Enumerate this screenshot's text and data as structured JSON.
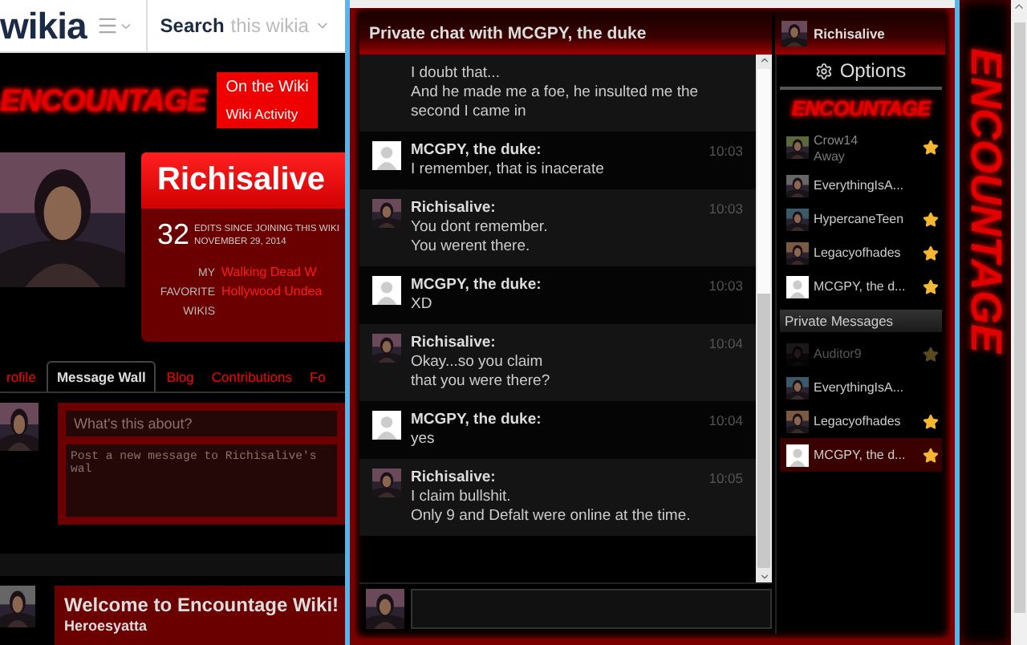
{
  "wiki": {
    "brand": "wikia",
    "search_label": "Search",
    "search_placeholder": "this wikia",
    "logo": "ENCOUNTAGE",
    "nav": {
      "title": "On the Wiki",
      "item": "Wiki Activity"
    },
    "profile": {
      "name": "Richisalive",
      "edits": "32",
      "edits_label": "EDITS SINCE JOINING THIS WIKI",
      "joined": "NOVEMBER 29, 2014",
      "favorites_label": "MY FAVORITE WIKIS",
      "favorites": [
        "Walking Dead W",
        "Hollywood Undea"
      ]
    },
    "tabs": [
      {
        "label": "rofile",
        "selected": false
      },
      {
        "label": "Message Wall",
        "selected": true
      },
      {
        "label": "Blog",
        "selected": false
      },
      {
        "label": "Contributions",
        "selected": false
      },
      {
        "label": "Fo",
        "selected": false
      }
    ],
    "wall": {
      "title_placeholder": "What's this about?",
      "body_placeholder": "Post a new message to Richisalive's wal"
    },
    "thread": {
      "title": "Welcome to Encountage Wiki!",
      "author": "Heroesyatta"
    }
  },
  "chat": {
    "title": "Private chat with MCGPY, the duke",
    "me": "Richisalive",
    "messages": [
      {
        "lines": [
          "I doubt that...",
          "And he made me a foe, he insulted me the second I came in"
        ]
      },
      {
        "author": "MCGPY, the duke:",
        "avatar": {
          "kind": "default"
        },
        "time": "10:03",
        "lines": [
          "I remember, that is inacerate"
        ]
      },
      {
        "author": "Richisalive:",
        "time": "10:03",
        "lines": [
          "You dont remember.",
          "You werent there."
        ]
      },
      {
        "author": "MCGPY, the duke:",
        "avatar": {
          "kind": "default"
        },
        "time": "10:03",
        "lines": [
          "XD"
        ]
      },
      {
        "author": "Richisalive:",
        "time": "10:04",
        "lines": [
          "Okay...so you claim",
          "that you were there?"
        ]
      },
      {
        "author": "MCGPY, the duke:",
        "avatar": {
          "kind": "default"
        },
        "time": "10:04",
        "lines": [
          "yes"
        ]
      },
      {
        "author": "Richisalive:",
        "time": "10:05",
        "lines": [
          "I claim bullshit.",
          "Only 9 and Defalt were online at the time."
        ]
      }
    ],
    "options": "Options",
    "logo": "ENCOUNTAGE",
    "users": [
      {
        "name": "Crow14",
        "status": "Away",
        "away": true,
        "starred": true
      },
      {
        "name": "EverythingIsA...",
        "away": false,
        "starred": false
      },
      {
        "name": "HypercaneTeen",
        "away": false,
        "starred": true
      },
      {
        "name": "Legacyofhades",
        "away": false,
        "starred": true
      },
      {
        "name": "MCGPY, the d...",
        "away": false,
        "starred": true,
        "avatar": {
          "kind": "default"
        }
      }
    ],
    "private_header": "Private Messages",
    "private": [
      {
        "name": "Auditor9",
        "offline": true,
        "starred": true,
        "selected": false
      },
      {
        "name": "EverythingIsA...",
        "offline": false,
        "starred": false,
        "selected": false
      },
      {
        "name": "Legacyofhades",
        "offline": false,
        "starred": true,
        "selected": false
      },
      {
        "name": "MCGPY, the d...",
        "offline": false,
        "starred": true,
        "selected": true,
        "avatar": {
          "kind": "default"
        }
      }
    ]
  },
  "side_logo": "ENCOUNTAGE"
}
